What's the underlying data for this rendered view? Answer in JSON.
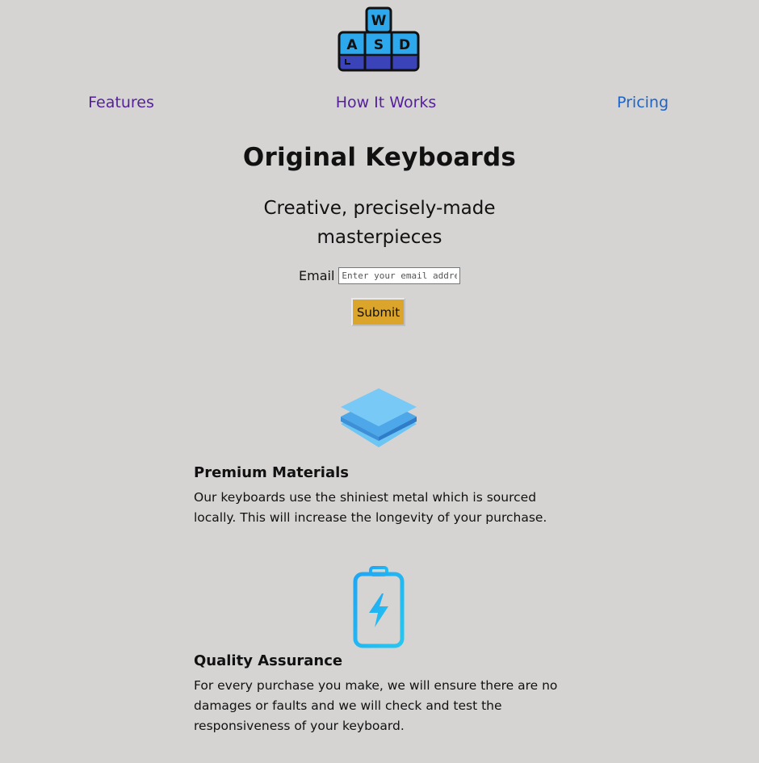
{
  "logo": {
    "icon": "wasd-keyboard-logo-icon",
    "keys": [
      "W",
      "A",
      "S",
      "D"
    ],
    "colors": {
      "keycap": "#2ea8ec",
      "keybase": "#3a44b8",
      "outline": "#111111"
    }
  },
  "nav": {
    "features": "Features",
    "how_it_works": "How It Works",
    "pricing": "Pricing",
    "colors": {
      "visited": "#55219b",
      "link": "#1e63c8"
    }
  },
  "hero": {
    "title": "Original Keyboards",
    "subtitle": "Creative, precisely-made masterpieces"
  },
  "form": {
    "email_label": "Email",
    "email_value": "",
    "email_placeholder": "Enter your email address",
    "submit_label": "Submit",
    "submit_color": "#dba42a"
  },
  "features": [
    {
      "icon": "layers-icon",
      "title": "Premium Materials",
      "description": "Our keyboards use the shiniest metal which is sourced locally. This will increase the longevity of your purchase."
    },
    {
      "icon": "battery-charging-icon",
      "title": "Quality Assurance",
      "description": "For every purchase you make, we will ensure there are no damages or faults and we will check and test the responsiveness of your keyboard."
    }
  ],
  "colors": {
    "background": "#d6d4d3"
  }
}
